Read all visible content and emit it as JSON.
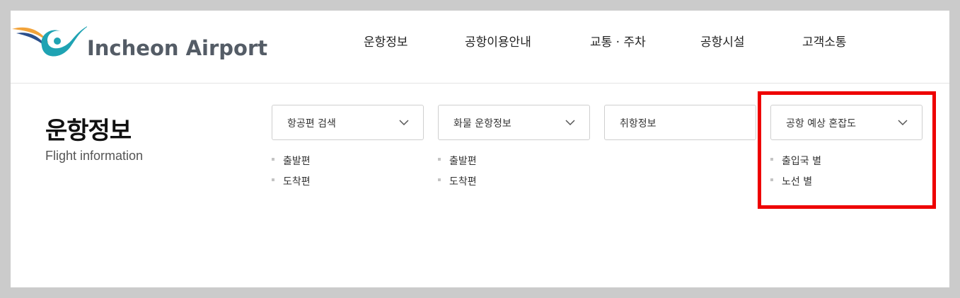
{
  "header": {
    "logo_text": "Incheon Airport",
    "nav": [
      "운항정보",
      "공항이용안내",
      "교통 · 주차",
      "공항시설",
      "고객소통"
    ]
  },
  "section": {
    "title": "운항정보",
    "subtitle": "Flight information"
  },
  "menus": [
    {
      "label": "항공편 검색",
      "has_dropdown": true,
      "items": [
        "출발편",
        "도착편"
      ]
    },
    {
      "label": "화물 운항정보",
      "has_dropdown": true,
      "items": [
        "출발편",
        "도착편"
      ]
    },
    {
      "label": "취항정보",
      "has_dropdown": false,
      "items": []
    },
    {
      "label": "공항 예상 혼잡도",
      "has_dropdown": true,
      "items": [
        "출입국 별",
        "노선 별"
      ]
    }
  ],
  "colors": {
    "highlight_border": "#ee0000",
    "logo_swoosh_teal": "#1fa3b3",
    "logo_swoosh_orange": "#f2a33a",
    "logo_swoosh_navy": "#2b4f8c"
  }
}
